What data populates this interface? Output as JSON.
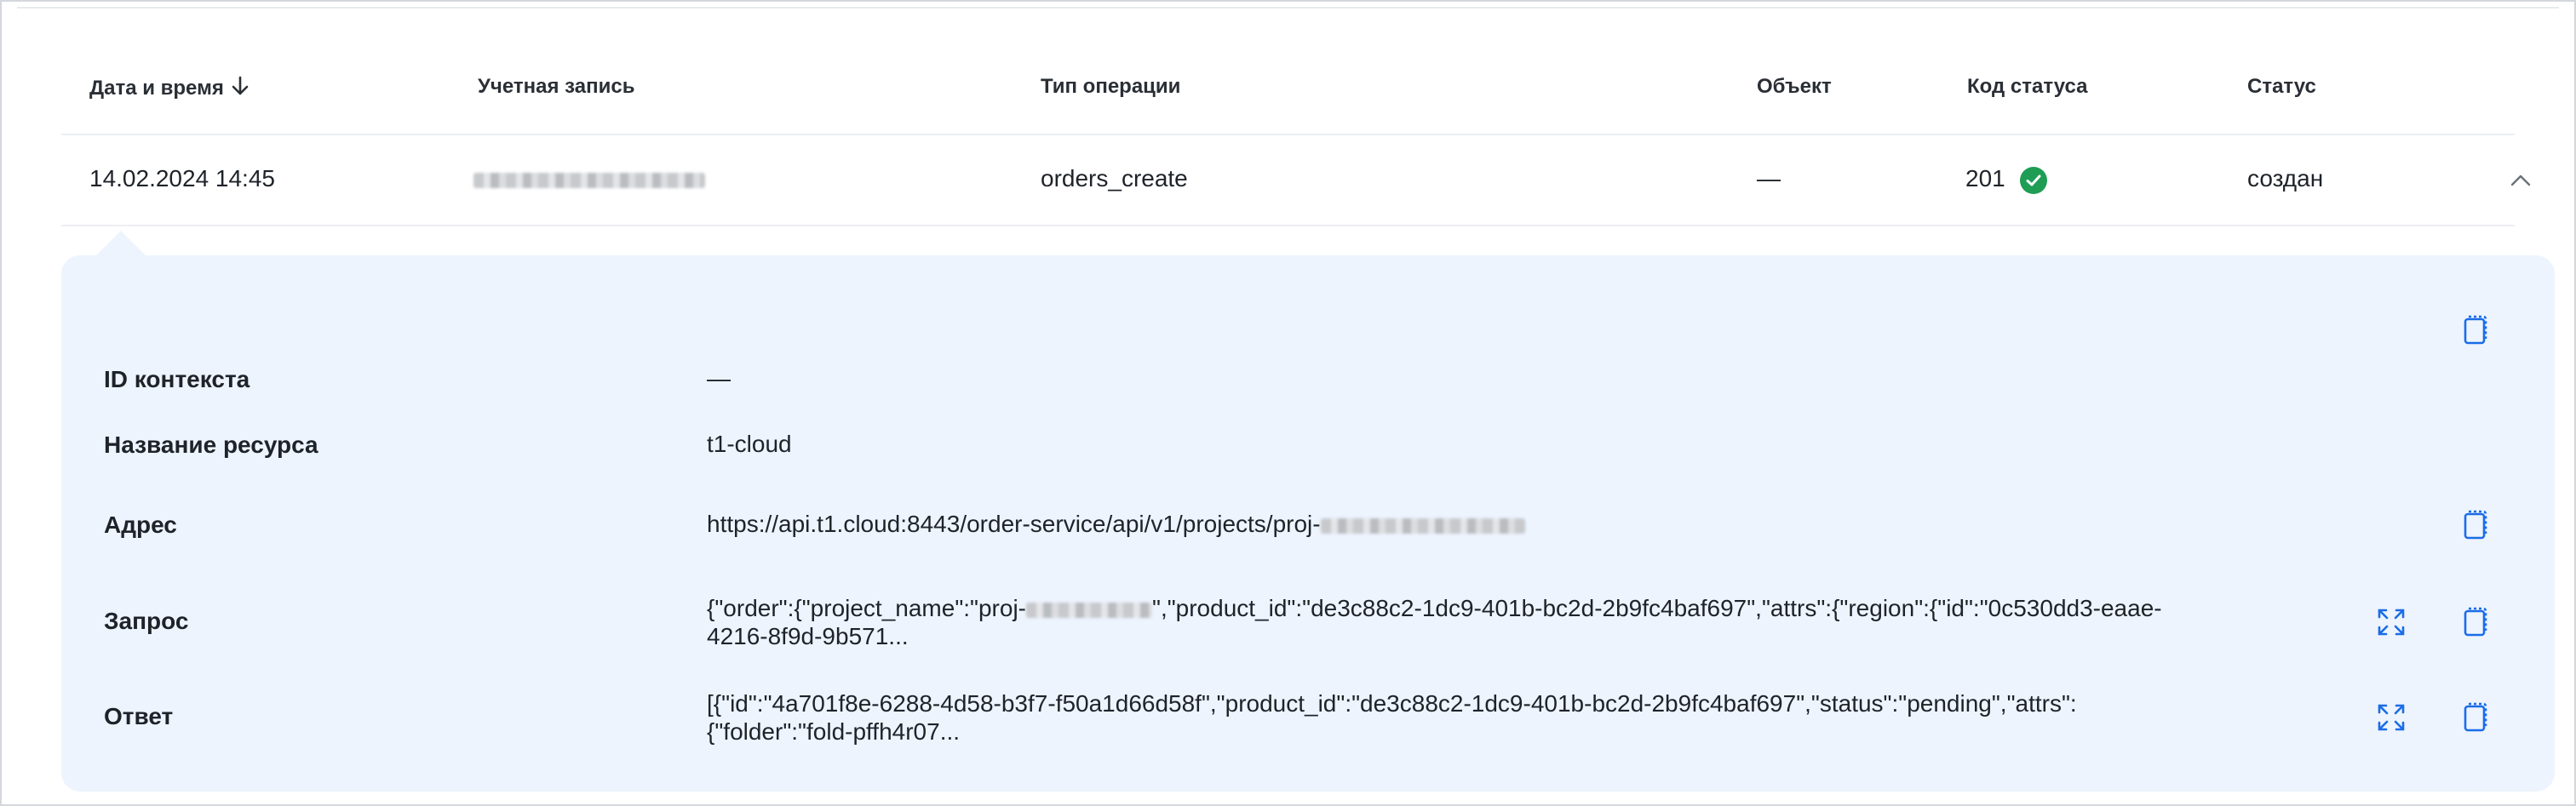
{
  "table": {
    "columns": [
      {
        "label": "Дата и время",
        "sort": "desc"
      },
      {
        "label": "Учетная запись"
      },
      {
        "label": "Тип операции"
      },
      {
        "label": "Объект"
      },
      {
        "label": "Код статуса"
      },
      {
        "label": "Статус"
      }
    ],
    "row": {
      "datetime": "14.02.2024 14:45",
      "operation_type": "orders_create",
      "object": "—",
      "status_code": "201",
      "status": "создан"
    }
  },
  "details": {
    "context_id": {
      "label": "ID контекста",
      "value": "—"
    },
    "resource_name": {
      "label": "Название ресурса",
      "value": "t1-cloud"
    },
    "address": {
      "label": "Адрес",
      "value_prefix": "https://api.t1.cloud:8443/order-service/api/v1/projects/proj-"
    },
    "request": {
      "label": "Запрос",
      "part1": "{\"order\":{\"project_name\":\"proj-",
      "part2": "\",\"product_id\":\"de3c88c2-1dc9-401b-bc2d-2b9fc4baf697\",\"attrs\":{\"region\":{\"id\":\"0c530dd3-eaae-",
      "line2": "4216-8f9d-9b571..."
    },
    "response": {
      "label": "Ответ",
      "line1": "[{\"id\":\"4a701f8e-6288-4d58-b3f7-f50a1d66d58f\",\"product_id\":\"de3c88c2-1dc9-401b-bc2d-2b9fc4baf697\",\"status\":\"pending\",\"attrs\":",
      "line2": "{\"folder\":\"fold-pffh4r07..."
    }
  },
  "colors": {
    "panel_bg": "#edf4fe",
    "icon_blue": "#1a6ce8",
    "success_green": "#1f9d55"
  },
  "icons": [
    "arrow-down-icon",
    "check-circle-icon",
    "chevron-up-icon",
    "copy-icon",
    "expand-icon"
  ]
}
